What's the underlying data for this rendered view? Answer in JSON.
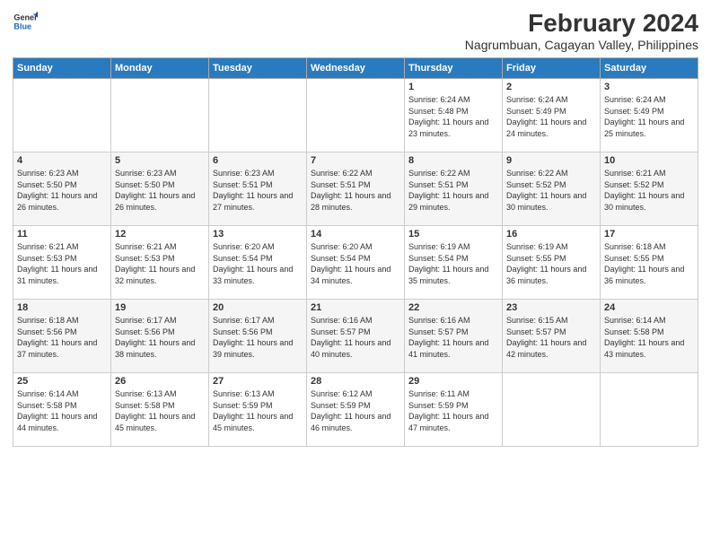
{
  "logo": {
    "line1": "General",
    "line2": "Blue"
  },
  "title": "February 2024",
  "location": "Nagrumbuan, Cagayan Valley, Philippines",
  "days_of_week": [
    "Sunday",
    "Monday",
    "Tuesday",
    "Wednesday",
    "Thursday",
    "Friday",
    "Saturday"
  ],
  "weeks": [
    [
      {
        "day": "",
        "sunrise": "",
        "sunset": "",
        "daylight": ""
      },
      {
        "day": "",
        "sunrise": "",
        "sunset": "",
        "daylight": ""
      },
      {
        "day": "",
        "sunrise": "",
        "sunset": "",
        "daylight": ""
      },
      {
        "day": "",
        "sunrise": "",
        "sunset": "",
        "daylight": ""
      },
      {
        "day": "1",
        "sunrise": "Sunrise: 6:24 AM",
        "sunset": "Sunset: 5:48 PM",
        "daylight": "Daylight: 11 hours and 23 minutes."
      },
      {
        "day": "2",
        "sunrise": "Sunrise: 6:24 AM",
        "sunset": "Sunset: 5:49 PM",
        "daylight": "Daylight: 11 hours and 24 minutes."
      },
      {
        "day": "3",
        "sunrise": "Sunrise: 6:24 AM",
        "sunset": "Sunset: 5:49 PM",
        "daylight": "Daylight: 11 hours and 25 minutes."
      }
    ],
    [
      {
        "day": "4",
        "sunrise": "Sunrise: 6:23 AM",
        "sunset": "Sunset: 5:50 PM",
        "daylight": "Daylight: 11 hours and 26 minutes."
      },
      {
        "day": "5",
        "sunrise": "Sunrise: 6:23 AM",
        "sunset": "Sunset: 5:50 PM",
        "daylight": "Daylight: 11 hours and 26 minutes."
      },
      {
        "day": "6",
        "sunrise": "Sunrise: 6:23 AM",
        "sunset": "Sunset: 5:51 PM",
        "daylight": "Daylight: 11 hours and 27 minutes."
      },
      {
        "day": "7",
        "sunrise": "Sunrise: 6:22 AM",
        "sunset": "Sunset: 5:51 PM",
        "daylight": "Daylight: 11 hours and 28 minutes."
      },
      {
        "day": "8",
        "sunrise": "Sunrise: 6:22 AM",
        "sunset": "Sunset: 5:51 PM",
        "daylight": "Daylight: 11 hours and 29 minutes."
      },
      {
        "day": "9",
        "sunrise": "Sunrise: 6:22 AM",
        "sunset": "Sunset: 5:52 PM",
        "daylight": "Daylight: 11 hours and 30 minutes."
      },
      {
        "day": "10",
        "sunrise": "Sunrise: 6:21 AM",
        "sunset": "Sunset: 5:52 PM",
        "daylight": "Daylight: 11 hours and 30 minutes."
      }
    ],
    [
      {
        "day": "11",
        "sunrise": "Sunrise: 6:21 AM",
        "sunset": "Sunset: 5:53 PM",
        "daylight": "Daylight: 11 hours and 31 minutes."
      },
      {
        "day": "12",
        "sunrise": "Sunrise: 6:21 AM",
        "sunset": "Sunset: 5:53 PM",
        "daylight": "Daylight: 11 hours and 32 minutes."
      },
      {
        "day": "13",
        "sunrise": "Sunrise: 6:20 AM",
        "sunset": "Sunset: 5:54 PM",
        "daylight": "Daylight: 11 hours and 33 minutes."
      },
      {
        "day": "14",
        "sunrise": "Sunrise: 6:20 AM",
        "sunset": "Sunset: 5:54 PM",
        "daylight": "Daylight: 11 hours and 34 minutes."
      },
      {
        "day": "15",
        "sunrise": "Sunrise: 6:19 AM",
        "sunset": "Sunset: 5:54 PM",
        "daylight": "Daylight: 11 hours and 35 minutes."
      },
      {
        "day": "16",
        "sunrise": "Sunrise: 6:19 AM",
        "sunset": "Sunset: 5:55 PM",
        "daylight": "Daylight: 11 hours and 36 minutes."
      },
      {
        "day": "17",
        "sunrise": "Sunrise: 6:18 AM",
        "sunset": "Sunset: 5:55 PM",
        "daylight": "Daylight: 11 hours and 36 minutes."
      }
    ],
    [
      {
        "day": "18",
        "sunrise": "Sunrise: 6:18 AM",
        "sunset": "Sunset: 5:56 PM",
        "daylight": "Daylight: 11 hours and 37 minutes."
      },
      {
        "day": "19",
        "sunrise": "Sunrise: 6:17 AM",
        "sunset": "Sunset: 5:56 PM",
        "daylight": "Daylight: 11 hours and 38 minutes."
      },
      {
        "day": "20",
        "sunrise": "Sunrise: 6:17 AM",
        "sunset": "Sunset: 5:56 PM",
        "daylight": "Daylight: 11 hours and 39 minutes."
      },
      {
        "day": "21",
        "sunrise": "Sunrise: 6:16 AM",
        "sunset": "Sunset: 5:57 PM",
        "daylight": "Daylight: 11 hours and 40 minutes."
      },
      {
        "day": "22",
        "sunrise": "Sunrise: 6:16 AM",
        "sunset": "Sunset: 5:57 PM",
        "daylight": "Daylight: 11 hours and 41 minutes."
      },
      {
        "day": "23",
        "sunrise": "Sunrise: 6:15 AM",
        "sunset": "Sunset: 5:57 PM",
        "daylight": "Daylight: 11 hours and 42 minutes."
      },
      {
        "day": "24",
        "sunrise": "Sunrise: 6:14 AM",
        "sunset": "Sunset: 5:58 PM",
        "daylight": "Daylight: 11 hours and 43 minutes."
      }
    ],
    [
      {
        "day": "25",
        "sunrise": "Sunrise: 6:14 AM",
        "sunset": "Sunset: 5:58 PM",
        "daylight": "Daylight: 11 hours and 44 minutes."
      },
      {
        "day": "26",
        "sunrise": "Sunrise: 6:13 AM",
        "sunset": "Sunset: 5:58 PM",
        "daylight": "Daylight: 11 hours and 45 minutes."
      },
      {
        "day": "27",
        "sunrise": "Sunrise: 6:13 AM",
        "sunset": "Sunset: 5:59 PM",
        "daylight": "Daylight: 11 hours and 45 minutes."
      },
      {
        "day": "28",
        "sunrise": "Sunrise: 6:12 AM",
        "sunset": "Sunset: 5:59 PM",
        "daylight": "Daylight: 11 hours and 46 minutes."
      },
      {
        "day": "29",
        "sunrise": "Sunrise: 6:11 AM",
        "sunset": "Sunset: 5:59 PM",
        "daylight": "Daylight: 11 hours and 47 minutes."
      },
      {
        "day": "",
        "sunrise": "",
        "sunset": "",
        "daylight": ""
      },
      {
        "day": "",
        "sunrise": "",
        "sunset": "",
        "daylight": ""
      }
    ]
  ]
}
